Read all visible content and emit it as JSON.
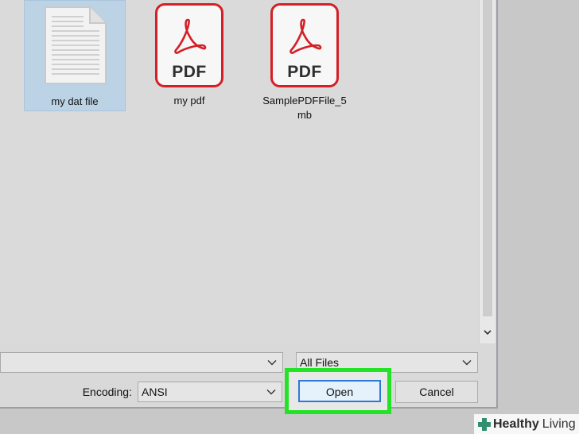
{
  "files": [
    {
      "label": "my dat file",
      "icon": "text-document-icon",
      "selected": true
    },
    {
      "label": "my pdf",
      "icon": "pdf-document-icon",
      "badge": "PDF"
    },
    {
      "label_line1": "SamplePDFFile_5",
      "label_line2": "mb",
      "icon": "pdf-document-icon",
      "badge": "PDF"
    }
  ],
  "file_type": {
    "value": "All Files"
  },
  "encoding": {
    "label": "Encoding:",
    "value": "ANSI"
  },
  "buttons": {
    "open": "Open",
    "cancel": "Cancel"
  },
  "watermark": {
    "bold": "Healthy",
    "rest": "Living"
  },
  "colors": {
    "pdf_red": "#d32027",
    "highlight_green": "#22e326",
    "selection": "#bcd3e6"
  }
}
